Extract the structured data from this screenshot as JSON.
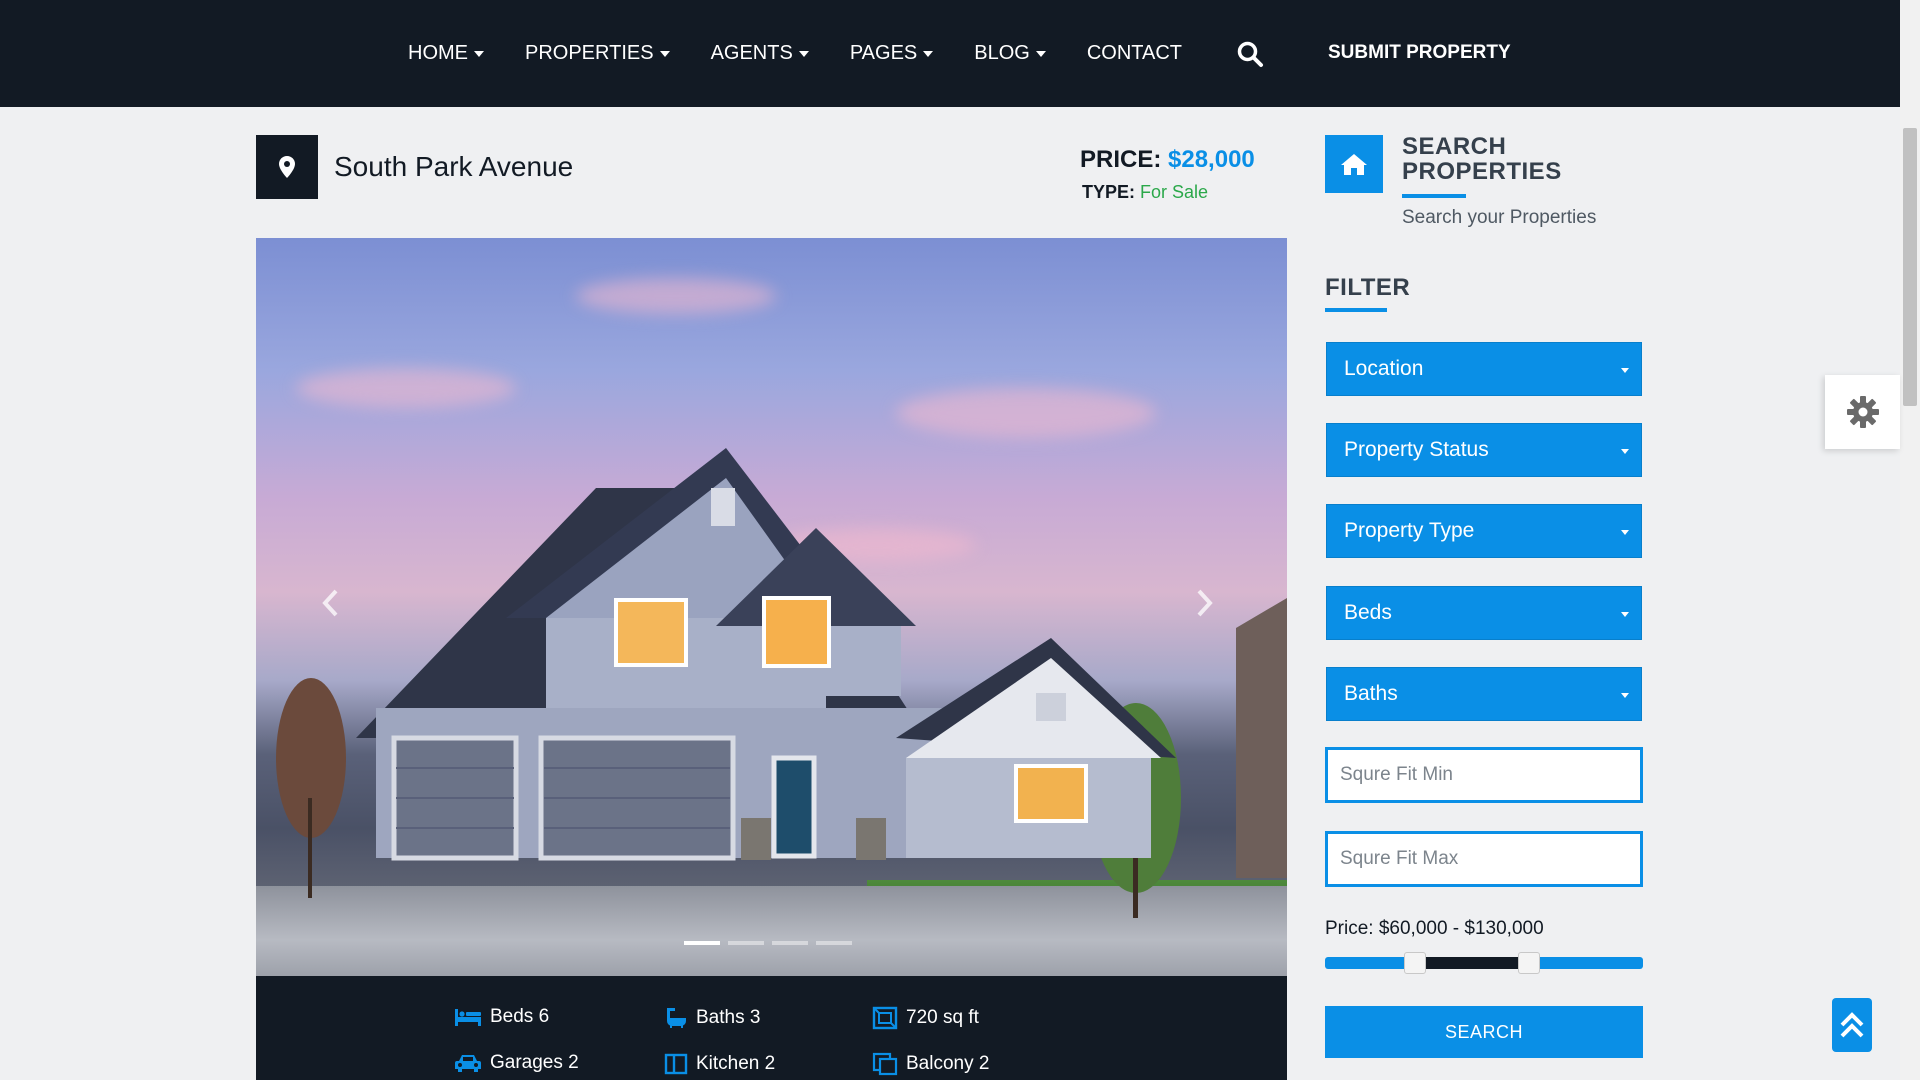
{
  "nav": {
    "items": [
      {
        "label": "HOME",
        "dropdown": true
      },
      {
        "label": "PROPERTIES",
        "dropdown": true
      },
      {
        "label": "AGENTS",
        "dropdown": true
      },
      {
        "label": "PAGES",
        "dropdown": true
      },
      {
        "label": "BLOG",
        "dropdown": true
      },
      {
        "label": "CONTACT",
        "dropdown": false
      }
    ],
    "search_icon": "search-icon",
    "submit_label": "SUBMIT PROPERTY"
  },
  "property": {
    "title": "South Park Avenue",
    "price_label": "PRICE:",
    "price_value": "$28,000",
    "type_label": "TYPE:",
    "type_value": "For Sale"
  },
  "carousel": {
    "slides": 4,
    "active": 0
  },
  "features": [
    {
      "icon": "bed-icon",
      "label": "Beds 6"
    },
    {
      "icon": "bath-icon",
      "label": "Baths 3"
    },
    {
      "icon": "area-icon",
      "label": "720 sq ft"
    },
    {
      "icon": "car-icon",
      "label": "Garages 2"
    },
    {
      "icon": "kitchen-icon",
      "label": "Kitchen 2"
    },
    {
      "icon": "balcony-icon",
      "label": "Balcony 2"
    }
  ],
  "sidebar": {
    "title_line1": "SEARCH",
    "title_line2": "PROPERTIES",
    "subtitle": "Search your Properties",
    "filter_title": "FILTER",
    "selects": [
      "Location",
      "Property Status",
      "Property Type",
      "Beds",
      "Baths"
    ],
    "sqft_min_placeholder": "Squre Fit Min",
    "sqft_max_placeholder": "Squre Fit Max",
    "price_range_label": "Price: $60,000 - $130,000",
    "price_min": 60000,
    "price_max": 130000,
    "search_label": "SEARCH"
  },
  "colors": {
    "accent": "#0a8fe6",
    "dark": "#121a24",
    "for_sale": "#2ba84a"
  }
}
